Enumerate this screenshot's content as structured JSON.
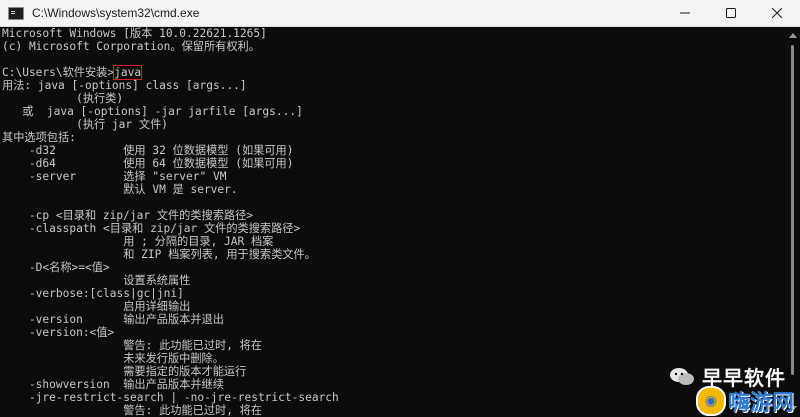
{
  "window": {
    "title": "C:\\Windows\\system32\\cmd.exe"
  },
  "console": {
    "highlighted_command": "java",
    "prompt": "C:\\Users\\软件安装>",
    "lines": [
      "Microsoft Windows [版本 10.0.22621.1265]",
      "(c) Microsoft Corporation。保留所有权利。",
      "",
      "",
      "用法: java [-options] class [args...]",
      "           (执行类)",
      "   或  java [-options] -jar jarfile [args...]",
      "           (执行 jar 文件)",
      "其中选项包括:",
      "    -d32          使用 32 位数据模型 (如果可用)",
      "    -d64          使用 64 位数据模型 (如果可用)",
      "    -server       选择 \"server\" VM",
      "                  默认 VM 是 server.",
      "",
      "    -cp <目录和 zip/jar 文件的类搜索路径>",
      "    -classpath <目录和 zip/jar 文件的类搜索路径>",
      "                  用 ; 分隔的目录, JAR 档案",
      "                  和 ZIP 档案列表, 用于搜索类文件。",
      "    -D<名称>=<值>",
      "                  设置系统属性",
      "    -verbose:[class|gc|jni]",
      "                  启用详细输出",
      "    -version      输出产品版本并退出",
      "    -version:<值>",
      "                  警告: 此功能已过时, 将在",
      "                  未来发行版中删除。",
      "                  需要指定的版本才能运行",
      "    -showversion  输出产品版本并继续",
      "    -jre-restrict-search | -no-jre-restrict-search",
      "                  警告: 此功能已过时, 将在"
    ]
  },
  "watermark": {
    "wechat_text": "早早软件",
    "site_text": "嗨游网",
    "icons": [
      "wechat-icon",
      "site-logo-icon"
    ]
  },
  "colors": {
    "console_bg": "#0c0c0c",
    "console_text": "#c8c8c8",
    "highlight": "#e0201c",
    "titlebar_bg": "#f3f3f3"
  }
}
